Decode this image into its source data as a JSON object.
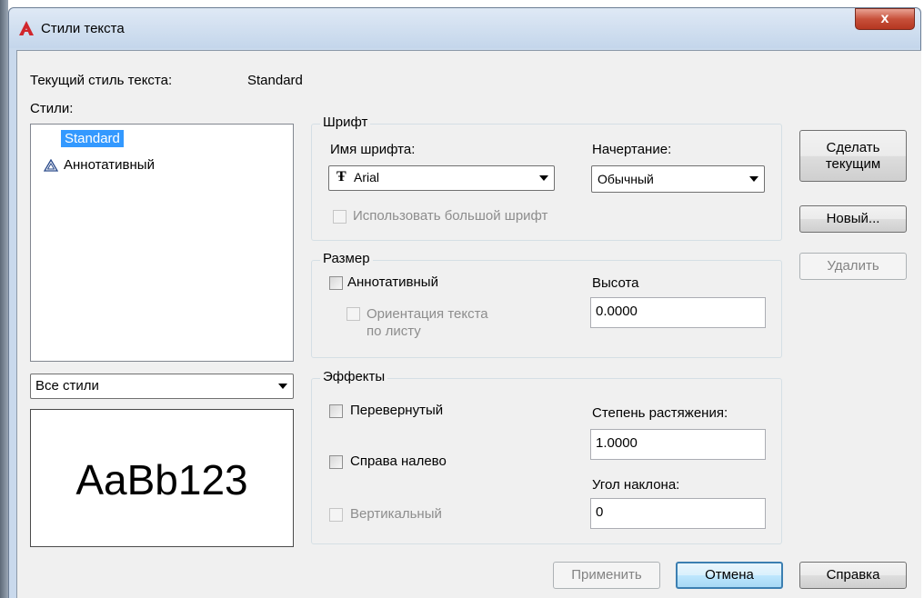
{
  "dialog": {
    "title": "Стили текста",
    "close_label": "x"
  },
  "current_style": {
    "label": "Текущий стиль текста:",
    "value": "Standard"
  },
  "styles": {
    "label": "Стили:",
    "items": [
      {
        "name": "Standard",
        "selected": true,
        "annotative": false
      },
      {
        "name": "Аннотативный",
        "selected": false,
        "annotative": true
      }
    ],
    "filter_value": "Все стили",
    "preview_text": "AaBb123"
  },
  "font": {
    "legend": "Шрифт",
    "name_label": "Имя шрифта:",
    "name_value": "Arial",
    "font_icon": "truetype-font-icon",
    "style_label": "Начертание:",
    "style_value": "Обычный",
    "big_font_label": "Использовать большой шрифт"
  },
  "size": {
    "legend": "Размер",
    "annotative_label": "Аннотативный",
    "orientation_label_line1": "Ориентация текста",
    "orientation_label_line2": "по листу",
    "height_label": "Высота",
    "height_value": "0.0000"
  },
  "effects": {
    "legend": "Эффекты",
    "upside_down_label": "Перевернутый",
    "backwards_label": "Справа налево",
    "vertical_label": "Вертикальный",
    "width_factor_label": "Степень растяжения:",
    "width_factor_value": "1.0000",
    "oblique_label": "Угол наклона:",
    "oblique_value": "0"
  },
  "buttons": {
    "set_current_line1": "Сделать",
    "set_current_line2": "текущим",
    "new": "Новый...",
    "delete": "Удалить",
    "apply": "Применить",
    "cancel": "Отмена",
    "help": "Справка"
  },
  "colors": {
    "selection": "#3399ff",
    "close_button": "#c7503a",
    "app_icon": "#d1262c"
  }
}
